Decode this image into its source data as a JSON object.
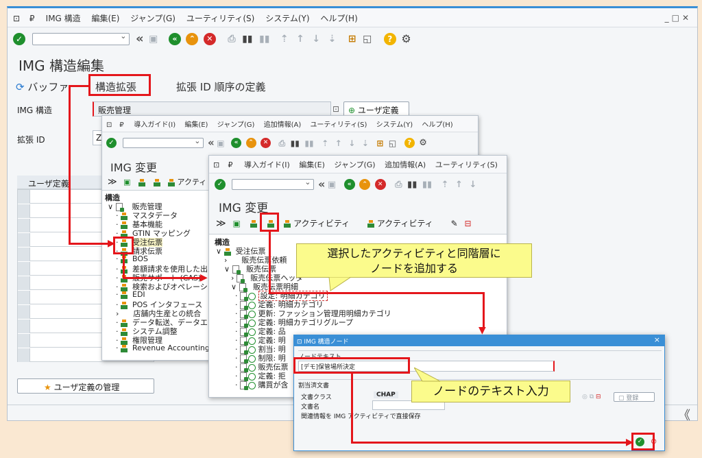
{
  "main": {
    "menu": [
      "IMG 構造",
      "編集(E)",
      "ジャンプ(G)",
      "ユーティリティ(S)",
      "システム(Y)",
      "ヘルプ(H)"
    ],
    "win_controls": [
      "_",
      "□",
      "✕"
    ],
    "title": "IMG 構造編集",
    "tabs": [
      "バッファ",
      "構造拡張",
      "拡張 ID 順序の定義"
    ],
    "img_label": "IMG 構造",
    "img_value": "販売管理",
    "ext_label": "拡張 ID",
    "ext_value": "Z",
    "user_def_button": "ユーザ定義",
    "grid_header": "ユーザ定義",
    "manage_button": "ユーザ定義の管理",
    "bottom_nav": "《"
  },
  "win2": {
    "menu": [
      "導入ガイド(I)",
      "編集(E)",
      "ジャンプ(G)",
      "追加情報(A)",
      "ユーティリティ(S)",
      "システム(Y)",
      "ヘルプ(H)"
    ],
    "title": "IMG 変更",
    "toolbar_text": "アクティ",
    "tree_header": "構造",
    "tree": [
      "販売管理",
      "マスタデータ",
      "基本機能",
      "GTIN マッピング",
      "受注伝票",
      "請求伝票",
      "BOS",
      "差額請求を使用した出",
      "販売サポート (CAS)",
      "検索およびオペレーショ",
      "EDI",
      "POS インタフェース",
      "店舗内生産との統合",
      "データ転送、データエー",
      "システム調整",
      "権限管理",
      "Revenue Accounting"
    ]
  },
  "win3": {
    "menu": [
      "導入ガイド(I)",
      "編集(E)",
      "ジャンプ(G)",
      "追加情報(A)",
      "ユーティリティ(S)"
    ],
    "title": "IMG 変更",
    "activity1": "アクティビティ",
    "activity2": "アクティビティ",
    "tree_header": "構造",
    "tree": [
      "受注伝票",
      "販売伝票依頼",
      "販売伝票",
      "販売伝票ヘッダ",
      "販売伝票明細",
      "設定: 明細カテゴリ",
      "定義: 明細カテゴリ",
      "更新: ファッション管理用明細カテゴリ",
      "定義: 明細カテゴリグループ",
      "定義: 品",
      "定義: 明",
      "割当: 明",
      "制限: 明",
      "販売伝票",
      "定義: 拒",
      "購買が含"
    ]
  },
  "dialog": {
    "title": "IMG 構造ノード",
    "close": "×",
    "node_text_label": "ノードテキスト",
    "node_text_value": "[デモ]保管場所決定",
    "assigned_docs_label": "割当済文書",
    "doc_class_label": "文書クラス",
    "doc_class_value": "CHAP",
    "doc_name_label": "文書名",
    "register_button": "登録",
    "save_note": "関連情報を IMG アクティビティで直接保存"
  },
  "callouts": {
    "top": "選択したアクティビティと同階層に\nノードを追加する",
    "bottom": "ノードのテキスト入力"
  },
  "colors": {
    "highlight": "#e4161b",
    "callout": "#fbfb8c",
    "background": "#fae8d2",
    "sap_green": "#1f8f2d"
  }
}
